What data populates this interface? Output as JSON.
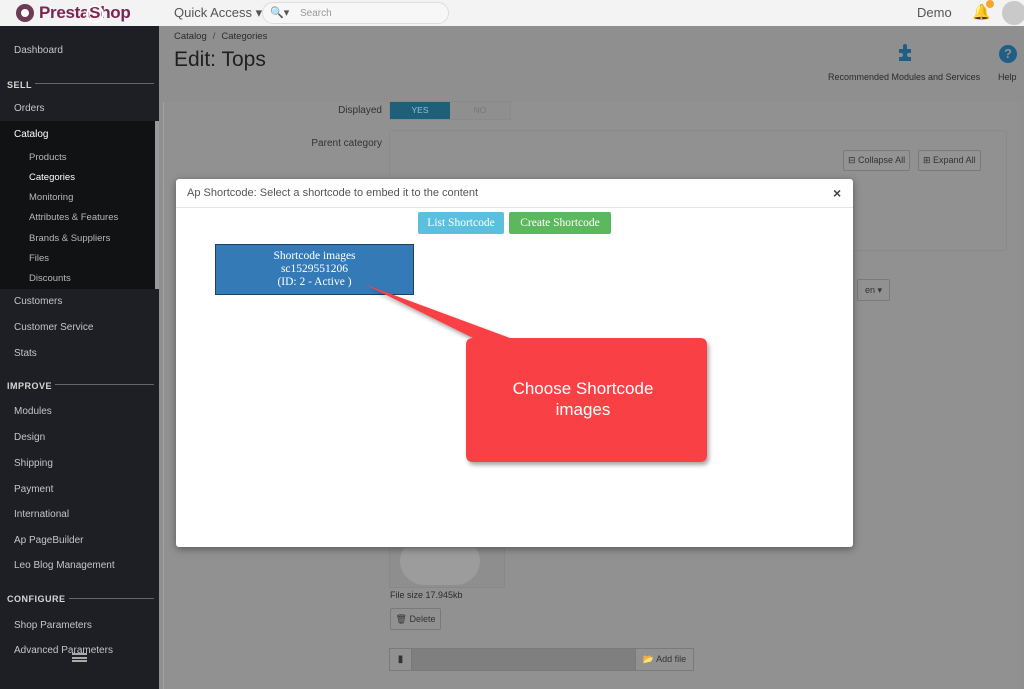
{
  "topbar": {
    "logo_text": "PrestaShop",
    "quick_access": "Quick Access ▾",
    "search_icon": "search-icon",
    "search_placeholder": "Search",
    "user": "Demo",
    "notifications_icon": "bell-icon"
  },
  "sidebar": {
    "dashboard": "Dashboard",
    "sell": "SELL",
    "orders": "Orders",
    "catalog": "Catalog",
    "catalog_items": [
      "Products",
      "Categories",
      "Monitoring",
      "Attributes & Features",
      "Brands & Suppliers",
      "Files",
      "Discounts"
    ],
    "customers": "Customers",
    "customer_service": "Customer Service",
    "stats": "Stats",
    "improve": "IMPROVE",
    "improve_items": [
      "Modules",
      "Design",
      "Shipping",
      "Payment",
      "International",
      "Ap PageBuilder",
      "Leo Blog Management"
    ],
    "configure": "CONFIGURE",
    "configure_items": [
      "Shop Parameters",
      "Advanced Parameters"
    ]
  },
  "header": {
    "breadcrumb": [
      "Catalog",
      "Categories"
    ],
    "breadcrumb_sep": "/",
    "title": "Edit: Tops",
    "recommended": "Recommended Modules and Services",
    "help": "Help"
  },
  "form": {
    "displayed_label": "Displayed",
    "yes": "YES",
    "no": "NO",
    "parent_label": "Parent category",
    "collapse_all": "⊟ Collapse All",
    "expand_all": "⊞ Expand All",
    "lang": "en ▾",
    "file_size": "File size 17.945kb",
    "delete": "🗑 Delete",
    "file_icon": "▮",
    "add_file": "📂 Add file"
  },
  "modal": {
    "title": "Ap Shortcode: Select a shortcode to embed it to the content",
    "close": "×",
    "list_button": "List Shortcode",
    "create_button": "Create Shortcode",
    "shortcode": {
      "line1": "Shortcode images",
      "line2": "sc1529551206",
      "line3": "(ID: 2 - Active )"
    }
  },
  "annotation": {
    "text_line1": "Choose Shortcode",
    "text_line2": "images",
    "color": "#f94144"
  }
}
